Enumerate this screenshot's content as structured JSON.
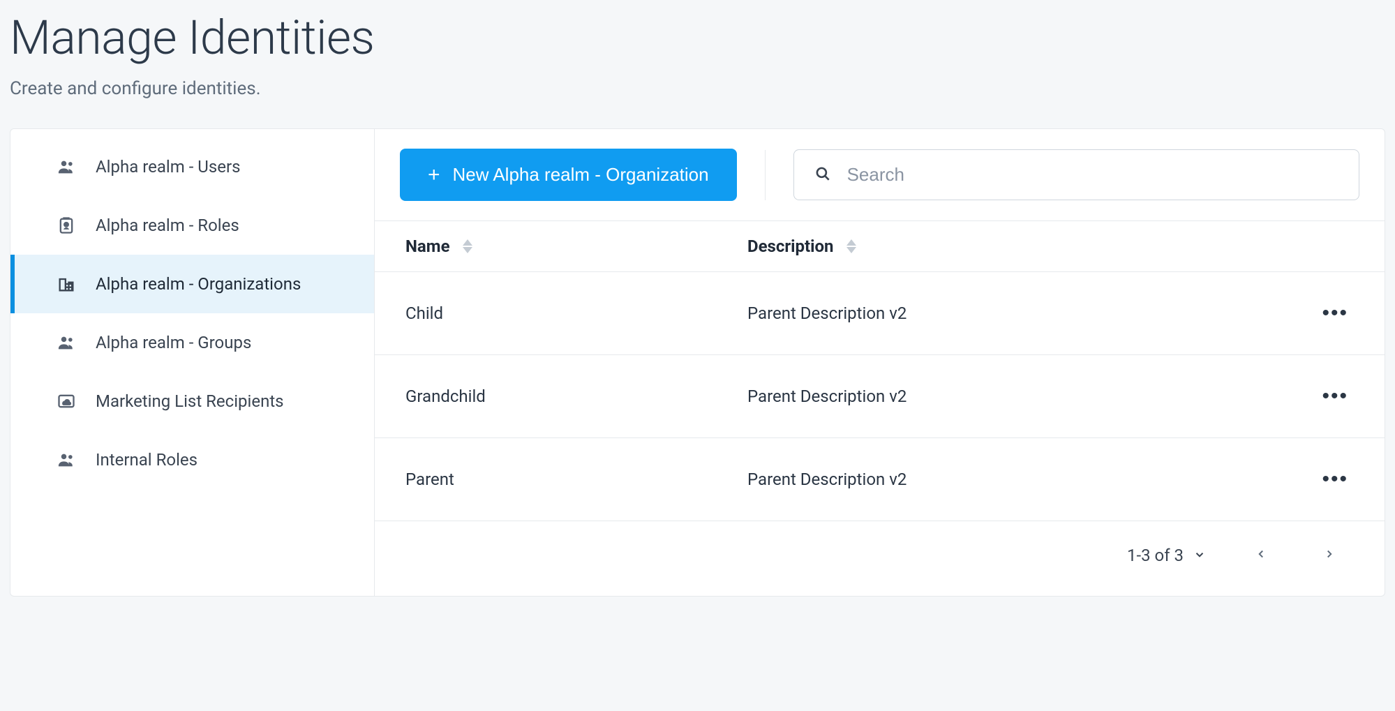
{
  "header": {
    "title": "Manage Identities",
    "subtitle": "Create and configure identities."
  },
  "sidebar": {
    "items": [
      {
        "label": "Alpha realm - Users",
        "icon": "group-icon",
        "active": false
      },
      {
        "label": "Alpha realm - Roles",
        "icon": "badge-icon",
        "active": false
      },
      {
        "label": "Alpha realm - Organizations",
        "icon": "domain-icon",
        "active": true
      },
      {
        "label": "Alpha realm - Groups",
        "icon": "group-icon",
        "active": false
      },
      {
        "label": "Marketing List Recipients",
        "icon": "cloud-icon",
        "active": false
      },
      {
        "label": "Internal Roles",
        "icon": "group-icon",
        "active": false
      }
    ]
  },
  "toolbar": {
    "new_button_label": "New Alpha realm - Organization",
    "search_placeholder": "Search"
  },
  "table": {
    "columns": [
      {
        "label": "Name",
        "sortable": true
      },
      {
        "label": "Description",
        "sortable": true
      }
    ],
    "rows": [
      {
        "name": "Child",
        "description": "Parent Description v2"
      },
      {
        "name": "Grandchild",
        "description": "Parent Description v2"
      },
      {
        "name": "Parent",
        "description": "Parent Description v2"
      }
    ]
  },
  "pagination": {
    "range_label": "1-3 of 3"
  }
}
